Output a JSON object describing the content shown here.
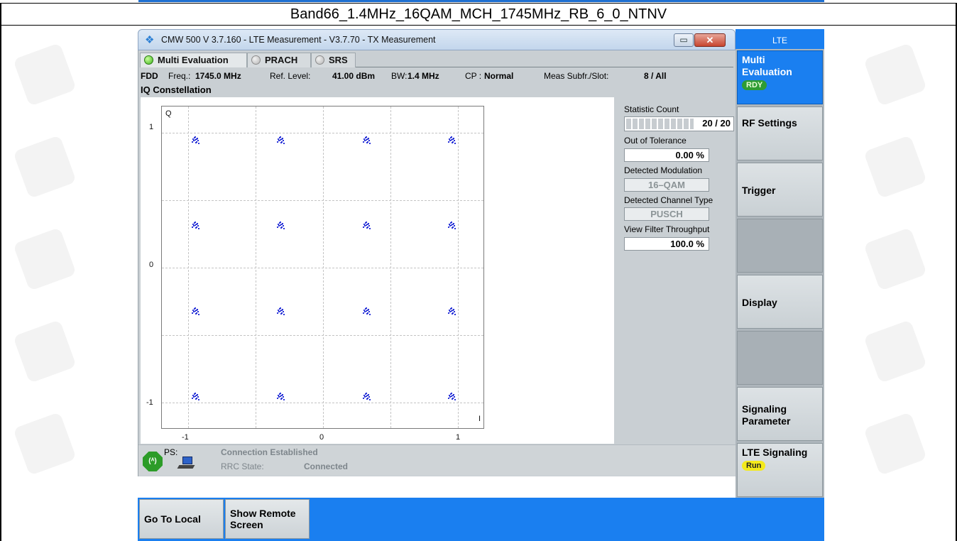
{
  "doc_title": "Band66_1.4MHz_16QAM_MCH_1745MHz_RB_6_0_NTNV",
  "window": {
    "title": "CMW 500 V 3.7.160 - LTE Measurement  - V3.7.70 - TX Measurement",
    "minimize_glyph": "▭",
    "close_glyph": "✕"
  },
  "tabs": [
    {
      "label": "Multi Evaluation",
      "active": true
    },
    {
      "label": "PRACH",
      "active": false
    },
    {
      "label": "SRS",
      "active": false
    }
  ],
  "info": {
    "duplex": "FDD",
    "freq_label": "Freq.:",
    "freq_value": "1745.0 MHz",
    "ref_label": "Ref. Level:",
    "ref_value": "41.00 dBm",
    "bw_label": "BW:",
    "bw_value": "1.4 MHz",
    "cp_label": "CP :",
    "cp_value": "Normal",
    "meas_label": "Meas Subfr./Slot:",
    "meas_value": "8  / All"
  },
  "section_title": "IQ Constellation",
  "plot": {
    "q_label": "Q",
    "i_label": "I",
    "y_ticks": [
      "1",
      "0",
      "-1"
    ],
    "x_ticks": [
      "-1",
      "0",
      "1"
    ]
  },
  "chart_data": {
    "type": "scatter",
    "title": "IQ Constellation",
    "xlabel": "I",
    "ylabel": "Q",
    "xlim": [
      -1.2,
      1.2
    ],
    "ylim": [
      -1.2,
      1.2
    ],
    "grid": true,
    "series": [
      {
        "x": [
          -0.95,
          -0.32,
          0.32,
          0.95,
          -0.95,
          -0.32,
          0.32,
          0.95,
          -0.95,
          -0.32,
          0.32,
          0.95,
          -0.95,
          -0.32,
          0.32,
          0.95
        ],
        "y": [
          0.95,
          0.95,
          0.95,
          0.95,
          0.32,
          0.32,
          0.32,
          0.32,
          -0.32,
          -0.32,
          -0.32,
          -0.32,
          -0.95,
          -0.95,
          -0.95,
          -0.95
        ]
      }
    ]
  },
  "stats": {
    "statistic_count_label": "Statistic Count",
    "statistic_count_value": "20 / 20",
    "statistic_count_fraction": 1.0,
    "out_of_tolerance_label": "Out of Tolerance",
    "out_of_tolerance_value": "0.00  %",
    "detected_modulation_label": "Detected Modulation",
    "detected_modulation_value": "16–QAM",
    "detected_channel_type_label": "Detected Channel Type",
    "detected_channel_type_value": "PUSCH",
    "view_filter_label": "View Filter Throughput",
    "view_filter_value": "100.0  %"
  },
  "status": {
    "ps_label": "PS:",
    "connection": "Connection Established",
    "rrc_label": "RRC State:",
    "rrc_value": "Connected",
    "antenna_glyph": "(ᴬ)"
  },
  "sidebar": {
    "header": "LTE",
    "multi_eval": "Multi Evaluation",
    "multi_eval_badge": "RDY",
    "rf_settings": "RF Settings",
    "trigger": "Trigger",
    "display": "Display",
    "signaling_parameter": "Signaling Parameter",
    "lte_signaling": "LTE Signaling",
    "lte_signaling_badge": "Run"
  },
  "bottom": {
    "go_to_local": "Go To Local",
    "show_remote": "Show Remote Screen"
  },
  "colors": {
    "accent": "#1a7ff0",
    "points": "#2a3adb",
    "led_active": "#3fb51d",
    "badge_rdy": "#2e9c33",
    "badge_run": "#f4ea1c"
  }
}
